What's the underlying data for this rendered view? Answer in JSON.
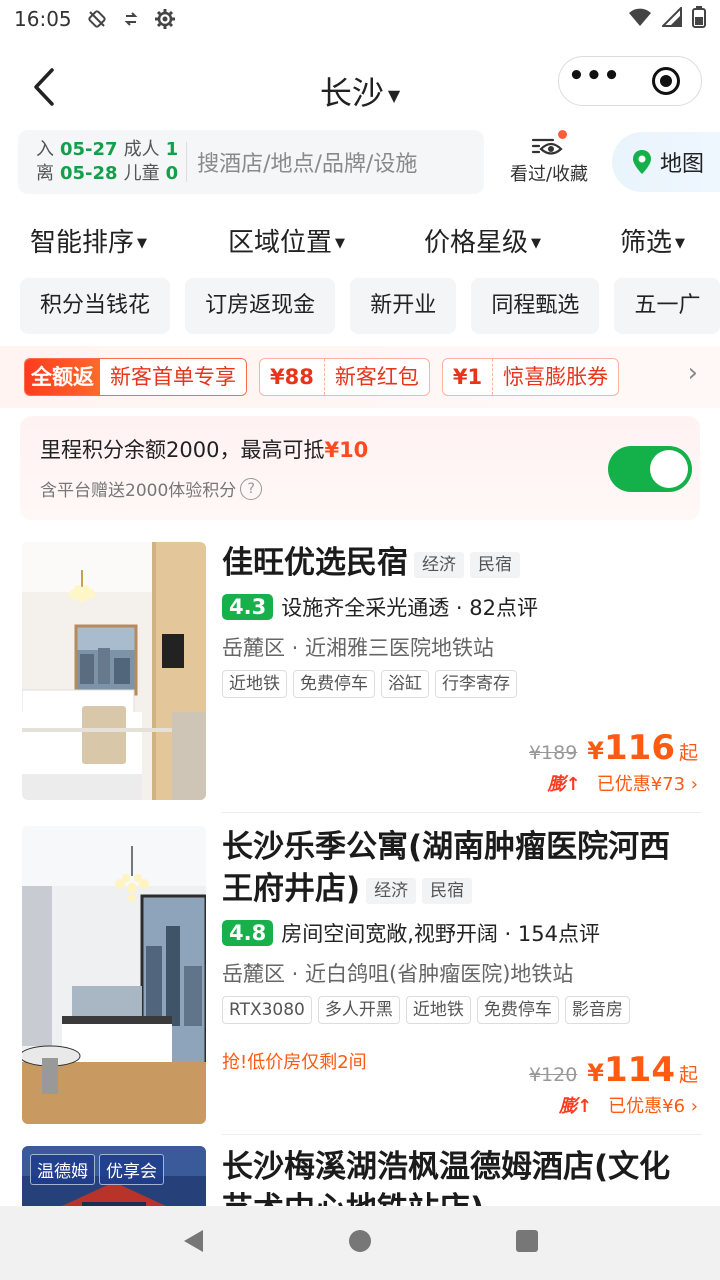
{
  "status_bar": {
    "time": "16:05"
  },
  "nav": {
    "title": "长沙"
  },
  "search": {
    "checkin_label": "入",
    "checkin_date": "05-27",
    "checkout_label": "离",
    "checkout_date": "05-28",
    "adults_label": "成人",
    "adults_count": "1",
    "children_label": "儿童",
    "children_count": "0",
    "placeholder": "搜酒店/地点/品牌/设施",
    "favorites_label": "看过/收藏",
    "map_label": "地图"
  },
  "sort": [
    "智能排序",
    "区域位置",
    "价格星级",
    "筛选"
  ],
  "quick_tags": [
    "积分当钱花",
    "订房返现金",
    "新开业",
    "同程甄选",
    "五一广"
  ],
  "promo": {
    "main_tag": "全额返",
    "main_text": "新客首单专享",
    "coupons": [
      {
        "amount": "¥88",
        "name": "新客红包"
      },
      {
        "amount": "¥1",
        "name": "惊喜膨胀券"
      }
    ]
  },
  "points": {
    "line1_prefix": "里程积分余额2000，最高可抵",
    "line1_amount": "¥10",
    "line2": "含平台赠送2000体验积分",
    "toggle_on": true
  },
  "hotels": [
    {
      "name": "佳旺优选民宿",
      "tags": [
        "经济",
        "民宿"
      ],
      "score": "4.3",
      "review": "设施齐全采光通透 · 82点评",
      "location": "岳麓区 · 近湘雅三医院地铁站",
      "features": [
        "近地铁",
        "免费停车",
        "浴缸",
        "行李寄存"
      ],
      "old_price": "¥189",
      "yen": "¥",
      "price": "116",
      "qi": "起",
      "peng": "膨↑",
      "discount": "已优惠¥73 ›"
    },
    {
      "name": "长沙乐季公寓(湖南肿瘤医院河西王府井店)",
      "tags": [
        "经济",
        "民宿"
      ],
      "score": "4.8",
      "review": "房间空间宽敞,视野开阔 · 154点评",
      "location": "岳麓区 · 近白鸽咀(省肿瘤医院)地铁站",
      "features": [
        "RTX3080",
        "多人开黑",
        "近地铁",
        "免费停车",
        "影音房"
      ],
      "urgent": "抢!低价房仅剩2间",
      "old_price": "¥120",
      "yen": "¥",
      "price": "114",
      "qi": "起",
      "peng": "膨↑",
      "discount": "已优惠¥6 ›"
    },
    {
      "name": "长沙梅溪湖浩枫温德姆酒店(文化艺术中心地铁站店)",
      "chain_tags": [
        "温德姆",
        "优享会"
      ]
    }
  ],
  "colors": {
    "brand_green": "#14a04a",
    "price_orange": "#ff5a12",
    "promo_red": "#e8341a"
  }
}
